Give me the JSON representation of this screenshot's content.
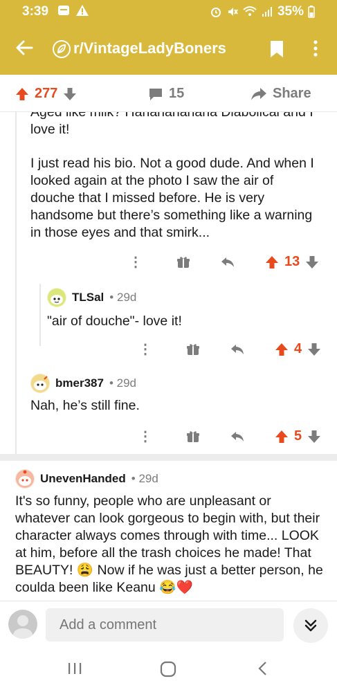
{
  "status_bar": {
    "time": "3:39",
    "battery": "35%"
  },
  "app_bar": {
    "title": "r/VintageLadyBoners"
  },
  "post_actions": {
    "vote_count": "277",
    "comment_count": "15",
    "share_label": "Share"
  },
  "thread": {
    "cut_text": "Aged like milk? Hahahahahaha Diabolical and I love it!",
    "parent_text": "I just read his bio. Not a good dude. And when I looked again at the photo I saw the air of douche that I missed before. He is very handsome but there’s something like a warning in those eyes and that smirk...",
    "parent_score": "13",
    "replies": [
      {
        "author": "TLSal",
        "age": "29d",
        "text": "\"air of douche\"- love it!",
        "score": "4"
      },
      {
        "author": "bmer387",
        "age": "29d",
        "text": "Nah, he’s still fine.",
        "score": "5"
      }
    ]
  },
  "top_comment": {
    "author": "UnevenHanded",
    "age": "29d",
    "text": "It's so funny, people who are unpleasant or whatever can look gorgeous to begin with, but their character always comes through with time... LOOK at him, before all the trash choices he made! That BEAUTY! 😩 Now if he was just a better person, he coulda been like Keanu 😂❤️"
  },
  "composer": {
    "placeholder": "Add a comment"
  },
  "colors": {
    "brand": "#d9b93c",
    "upvote": "#e8491d",
    "muted": "#7c7c7c"
  }
}
